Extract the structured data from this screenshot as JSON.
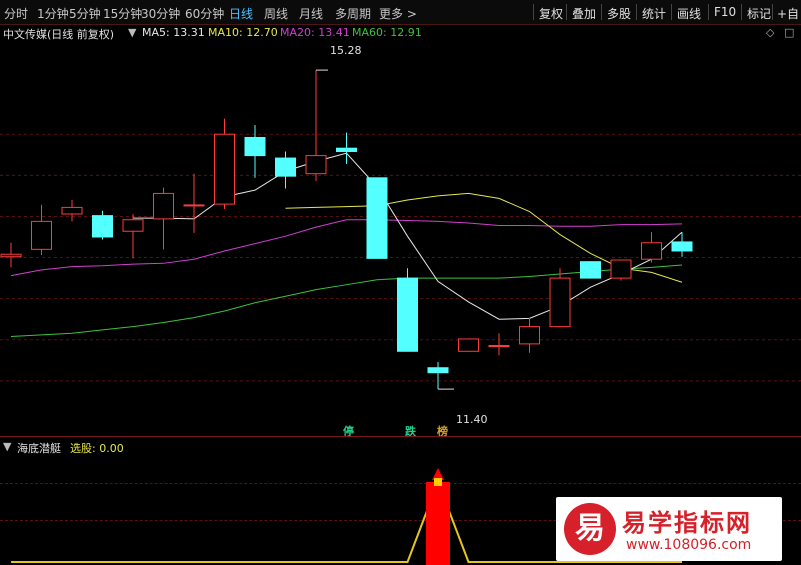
{
  "toolbar": {
    "periods": [
      "分时",
      "1分钟",
      "5分钟",
      "15分钟",
      "30分钟",
      "60分钟",
      "日线",
      "周线",
      "月线",
      "多周期",
      "更多 >"
    ],
    "active_period": "日线",
    "actions": [
      "复权",
      "叠加",
      "多股",
      "统计",
      "画线",
      "F10",
      "标记",
      "+自"
    ]
  },
  "main_chart": {
    "title": "中文传媒(日线 前复权)",
    "ma": [
      {
        "label": "MA5: 13.31",
        "color": "#e8e8e8"
      },
      {
        "label": "MA10: 12.70",
        "color": "#e6e64a"
      },
      {
        "label": "MA20: 13.41",
        "color": "#d040d0"
      },
      {
        "label": "MA60: 12.91",
        "color": "#3cc23c"
      }
    ],
    "high_label": "15.28",
    "low_label": "11.40",
    "tags": [
      {
        "text": "停",
        "color": "#22d08a"
      },
      {
        "text": "跌",
        "color": "#22d08a"
      },
      {
        "text": "榜",
        "color": "#d4a030"
      }
    ]
  },
  "chart_data": {
    "type": "candlestick",
    "candles": [
      {
        "o": 13.01,
        "c": 13.04,
        "h": 13.18,
        "l": 12.88
      },
      {
        "o": 13.1,
        "c": 13.44,
        "h": 13.64,
        "l": 13.03
      },
      {
        "o": 13.53,
        "c": 13.61,
        "h": 13.7,
        "l": 13.44
      },
      {
        "o": 13.51,
        "c": 13.25,
        "h": 13.57,
        "l": 13.22
      },
      {
        "o": 13.32,
        "c": 13.46,
        "h": 13.53,
        "l": 12.99
      },
      {
        "o": 13.47,
        "c": 13.78,
        "h": 13.85,
        "l": 13.1
      },
      {
        "o": 13.64,
        "c": 13.64,
        "h": 14.02,
        "l": 13.3
      },
      {
        "o": 13.65,
        "c": 14.5,
        "h": 14.69,
        "l": 13.59
      },
      {
        "o": 14.46,
        "c": 14.24,
        "h": 14.61,
        "l": 13.97
      },
      {
        "o": 14.21,
        "c": 13.99,
        "h": 14.29,
        "l": 13.84
      },
      {
        "o": 14.02,
        "c": 14.24,
        "h": 15.28,
        "l": 13.93
      },
      {
        "o": 14.33,
        "c": 14.29,
        "h": 14.52,
        "l": 14.14
      },
      {
        "o": 13.97,
        "c": 12.99,
        "h": 13.97,
        "l": 12.99
      },
      {
        "o": 12.75,
        "c": 11.86,
        "h": 12.87,
        "l": 11.86
      },
      {
        "o": 11.66,
        "c": 11.6,
        "h": 11.73,
        "l": 11.4
      },
      {
        "o": 11.86,
        "c": 12.01,
        "h": 12.01,
        "l": 11.86
      },
      {
        "o": 11.93,
        "c": 11.93,
        "h": 12.08,
        "l": 11.81
      },
      {
        "o": 11.95,
        "c": 12.16,
        "h": 12.27,
        "l": 11.84
      },
      {
        "o": 12.16,
        "c": 12.75,
        "h": 12.87,
        "l": 12.16
      },
      {
        "o": 12.95,
        "c": 12.75,
        "h": 12.95,
        "l": 12.75
      },
      {
        "o": 12.75,
        "c": 12.97,
        "h": 12.97,
        "l": 12.72
      },
      {
        "o": 12.98,
        "c": 13.18,
        "h": 13.31,
        "l": 12.94
      },
      {
        "o": 13.19,
        "c": 13.08,
        "h": 13.31,
        "l": 13.01
      }
    ],
    "ma5": [
      null,
      null,
      null,
      null,
      13.48,
      13.48,
      13.47,
      13.74,
      13.82,
      14.05,
      14.17,
      14.27,
      13.86,
      13.26,
      12.71,
      12.46,
      12.25,
      12.26,
      12.41,
      12.64,
      12.8,
      12.98,
      13.31
    ],
    "ma10": [
      null,
      null,
      null,
      null,
      null,
      null,
      null,
      null,
      null,
      13.6,
      13.61,
      13.62,
      13.63,
      13.7,
      13.75,
      13.78,
      13.72,
      13.56,
      13.28,
      13.05,
      12.87,
      12.82,
      12.7
    ],
    "ma20": [
      12.78,
      12.85,
      12.89,
      12.9,
      12.92,
      12.93,
      12.98,
      13.08,
      13.17,
      13.26,
      13.37,
      13.46,
      13.46,
      13.45,
      13.44,
      13.42,
      13.39,
      13.39,
      13.38,
      13.38,
      13.4,
      13.4,
      13.41
    ],
    "ma60": [
      12.04,
      12.06,
      12.08,
      12.12,
      12.16,
      12.21,
      12.27,
      12.35,
      12.45,
      12.53,
      12.61,
      12.67,
      12.73,
      12.75,
      12.75,
      12.75,
      12.75,
      12.77,
      12.8,
      12.83,
      12.86,
      12.88,
      12.91
    ],
    "ylim": [
      11.0,
      15.5
    ],
    "indicator": {
      "values": [
        0,
        0,
        0,
        0,
        0,
        0,
        0,
        0,
        0,
        0,
        0,
        0,
        0,
        0,
        1,
        0,
        0,
        0,
        0,
        0,
        0,
        0,
        0
      ]
    }
  },
  "indicator_panel": {
    "title": "海底潜艇",
    "pick_label": "选股: 0.00",
    "signal_icon": "up-arrow-icon"
  },
  "watermark": {
    "char": "易",
    "title": "易学指标网",
    "url": "www.108096.com"
  },
  "colors": {
    "up": "#ff3c3c",
    "down": "#54ffff",
    "ma5": "#e8e8e8",
    "ma10": "#e6e64a",
    "ma20": "#d040d0",
    "ma60": "#3cc23c",
    "indicator_bar": "#ff0000",
    "indicator_line": "#e6c619"
  }
}
